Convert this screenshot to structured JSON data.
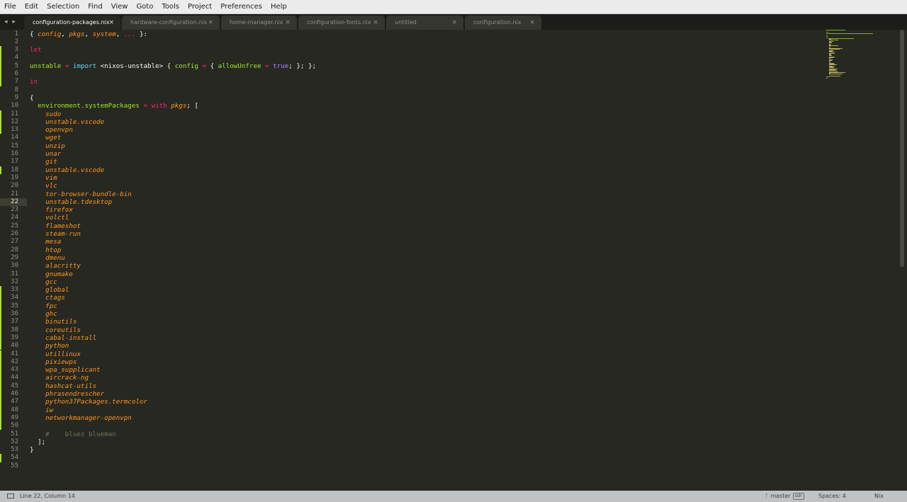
{
  "menu": [
    "File",
    "Edit",
    "Selection",
    "Find",
    "View",
    "Goto",
    "Tools",
    "Project",
    "Preferences",
    "Help"
  ],
  "tabs": [
    {
      "label": "configuration-packages.nix",
      "active": true
    },
    {
      "label": "hardware-configuration.nix",
      "active": false
    },
    {
      "label": "home-manager.nix",
      "active": false
    },
    {
      "label": "configuration-fonts.nix",
      "active": false
    },
    {
      "label": "untitled",
      "active": false
    },
    {
      "label": "configuration.nix",
      "active": false
    }
  ],
  "tab_nav": "◂ ▸",
  "tab_close_glyph": "×",
  "colors": {
    "background": "#272822",
    "foreground": "#f8f8f2",
    "keyword": "#f92672",
    "function": "#a6e22e",
    "parameter": "#fd971f",
    "constant": "#ae81ff",
    "comment": "#75715e",
    "builtin": "#66d9ef"
  },
  "editor": {
    "current_line": 22,
    "line_count": 55,
    "lines": [
      [
        [
          "{ ",
          "p"
        ],
        [
          "config",
          "par"
        ],
        [
          ", ",
          "p"
        ],
        [
          "pkgs",
          "par"
        ],
        [
          ", ",
          "p"
        ],
        [
          "system",
          "par"
        ],
        [
          ", ",
          "p"
        ],
        [
          "...",
          "kw"
        ],
        [
          " }:",
          "p"
        ]
      ],
      [],
      [
        [
          "let",
          "kw"
        ]
      ],
      [],
      [
        [
          "unstable",
          "fn"
        ],
        [
          " ",
          "p"
        ],
        [
          "=",
          "kw"
        ],
        [
          " ",
          "p"
        ],
        [
          "import",
          "bi"
        ],
        [
          " <nixos-unstable> { ",
          "p"
        ],
        [
          "config",
          "fn"
        ],
        [
          " ",
          "p"
        ],
        [
          "=",
          "kw"
        ],
        [
          " { ",
          "p"
        ],
        [
          "allowUnfree",
          "fn"
        ],
        [
          " ",
          "p"
        ],
        [
          "=",
          "kw"
        ],
        [
          " ",
          "p"
        ],
        [
          "true",
          "const"
        ],
        [
          "; }; };",
          "p"
        ]
      ],
      [],
      [
        [
          "in",
          "kw"
        ]
      ],
      [],
      [
        [
          "{",
          "p"
        ]
      ],
      [
        [
          "  ",
          "p"
        ],
        [
          "environment.systemPackages",
          "fn"
        ],
        [
          " ",
          "p"
        ],
        [
          "=",
          "kw"
        ],
        [
          " ",
          "p"
        ],
        [
          "with",
          "kw"
        ],
        [
          " ",
          "p"
        ],
        [
          "pkgs",
          "par"
        ],
        [
          "; [",
          "p"
        ]
      ],
      [
        [
          "    ",
          "p"
        ],
        [
          "sudo",
          "par"
        ]
      ],
      [
        [
          "    ",
          "p"
        ],
        [
          "unstable.vscode",
          "par"
        ]
      ],
      [
        [
          "    ",
          "p"
        ],
        [
          "openvpn",
          "par"
        ]
      ],
      [
        [
          "    ",
          "p"
        ],
        [
          "wget",
          "par"
        ]
      ],
      [
        [
          "    ",
          "p"
        ],
        [
          "unzip",
          "par"
        ]
      ],
      [
        [
          "    ",
          "p"
        ],
        [
          "unar",
          "par"
        ]
      ],
      [
        [
          "    ",
          "p"
        ],
        [
          "git",
          "par"
        ]
      ],
      [
        [
          "    ",
          "p"
        ],
        [
          "unstable.vscode",
          "par"
        ]
      ],
      [
        [
          "    ",
          "p"
        ],
        [
          "vim",
          "par"
        ]
      ],
      [
        [
          "    ",
          "p"
        ],
        [
          "vlc",
          "par"
        ]
      ],
      [
        [
          "    ",
          "p"
        ],
        [
          "tor-browser-bundle-bin",
          "par"
        ]
      ],
      [
        [
          "    ",
          "p"
        ],
        [
          "unstable.tdesktop",
          "par"
        ]
      ],
      [
        [
          "    ",
          "p"
        ],
        [
          "firefox",
          "par"
        ]
      ],
      [
        [
          "    ",
          "p"
        ],
        [
          "volctl",
          "par"
        ]
      ],
      [
        [
          "    ",
          "p"
        ],
        [
          "flameshot",
          "par"
        ]
      ],
      [
        [
          "    ",
          "p"
        ],
        [
          "steam-run",
          "par"
        ]
      ],
      [
        [
          "    ",
          "p"
        ],
        [
          "mesa",
          "par"
        ]
      ],
      [
        [
          "    ",
          "p"
        ],
        [
          "htop",
          "par"
        ]
      ],
      [
        [
          "    ",
          "p"
        ],
        [
          "dmenu",
          "par"
        ]
      ],
      [
        [
          "    ",
          "p"
        ],
        [
          "alacritty",
          "par"
        ]
      ],
      [
        [
          "    ",
          "p"
        ],
        [
          "gnumake",
          "par"
        ]
      ],
      [
        [
          "    ",
          "p"
        ],
        [
          "gcc",
          "par"
        ]
      ],
      [
        [
          "    ",
          "p"
        ],
        [
          "global",
          "par"
        ]
      ],
      [
        [
          "    ",
          "p"
        ],
        [
          "ctags",
          "par"
        ]
      ],
      [
        [
          "    ",
          "p"
        ],
        [
          "fpc",
          "par"
        ]
      ],
      [
        [
          "    ",
          "p"
        ],
        [
          "ghc",
          "par"
        ]
      ],
      [
        [
          "    ",
          "p"
        ],
        [
          "binutils",
          "par"
        ]
      ],
      [
        [
          "    ",
          "p"
        ],
        [
          "coreutils",
          "par"
        ]
      ],
      [
        [
          "    ",
          "p"
        ],
        [
          "cabal-install",
          "par"
        ]
      ],
      [
        [
          "    ",
          "p"
        ],
        [
          "python",
          "par"
        ]
      ],
      [
        [
          "    ",
          "p"
        ],
        [
          "utillinux",
          "par"
        ]
      ],
      [
        [
          "    ",
          "p"
        ],
        [
          "pixiewps",
          "par"
        ]
      ],
      [
        [
          "    ",
          "p"
        ],
        [
          "wpa_supplicant",
          "par"
        ]
      ],
      [
        [
          "    ",
          "p"
        ],
        [
          "aircrack-ng",
          "par"
        ]
      ],
      [
        [
          "    ",
          "p"
        ],
        [
          "hashcat-utils",
          "par"
        ]
      ],
      [
        [
          "    ",
          "p"
        ],
        [
          "phrasendrescher",
          "par"
        ]
      ],
      [
        [
          "    ",
          "p"
        ],
        [
          "python37Packages.termcolor",
          "par"
        ]
      ],
      [
        [
          "    ",
          "p"
        ],
        [
          "iw",
          "par"
        ]
      ],
      [
        [
          "    ",
          "p"
        ],
        [
          "networkmanager-openvpn",
          "par"
        ]
      ],
      [],
      [
        [
          "    ",
          "p"
        ],
        [
          "#    bluez blueman",
          "cm"
        ]
      ],
      [
        [
          "  ];",
          "p"
        ]
      ],
      [
        [
          "}",
          "p"
        ]
      ],
      [],
      []
    ],
    "modified_lines": [
      3,
      4,
      5,
      6,
      7,
      11,
      12,
      13,
      18,
      22,
      33,
      34,
      35,
      36,
      37,
      38,
      39,
      40,
      41,
      42,
      43,
      44,
      45,
      46,
      47,
      48,
      49,
      50,
      54
    ]
  },
  "status": {
    "cursor_position": "Line 22, Column 14",
    "git_branch": "master",
    "branch_badge": "ssh",
    "indentation": "Spaces: 4",
    "syntax": "Nix"
  }
}
